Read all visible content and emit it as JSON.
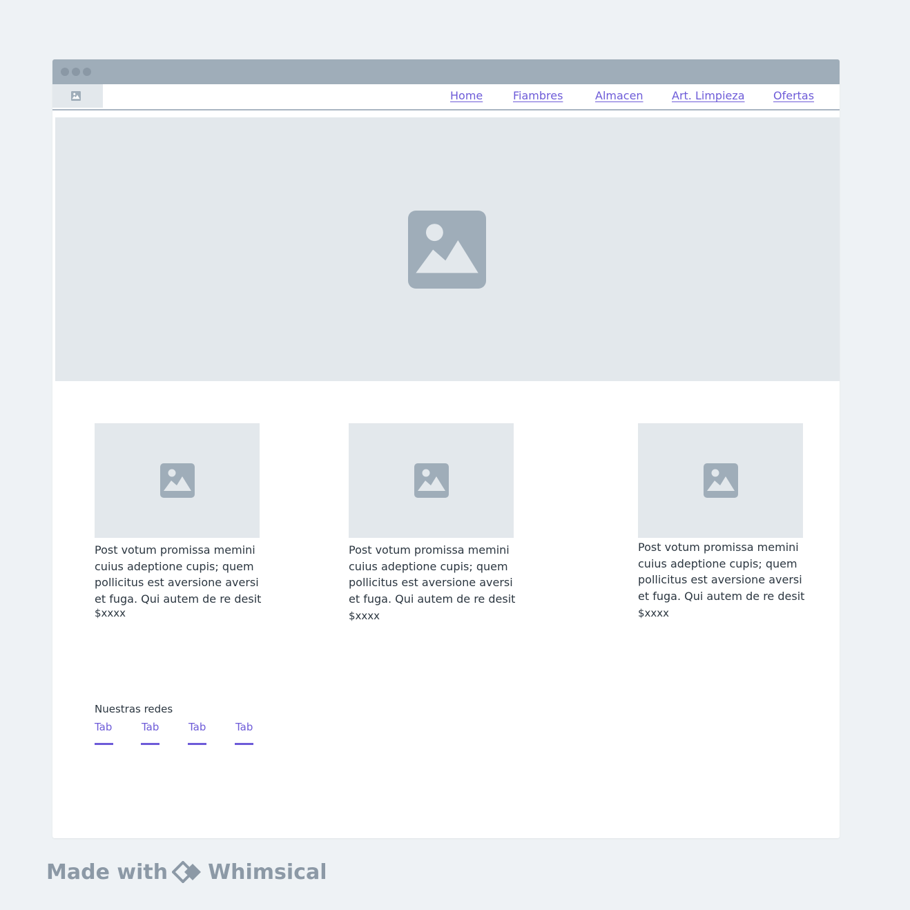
{
  "nav": {
    "links": [
      "Home",
      "Fiambres",
      "Almacen",
      "Art. Limpieza",
      "Ofertas"
    ]
  },
  "cards": [
    {
      "text": "Post votum promissa memini cuius adeptione cupis; quem pollicitus est aversione aversi et fuga. Qui autem de re desit",
      "price": "$xxxx"
    },
    {
      "text": "Post votum promissa memini cuius adeptione cupis; quem pollicitus est aversione aversi et fuga. Qui autem de re desit",
      "price": "$xxxx"
    },
    {
      "text": "Post votum promissa memini cuius adeptione cupis; quem pollicitus est aversione aversi et fuga. Qui autem de re desit",
      "price": "$xxxx"
    }
  ],
  "social": {
    "title": "Nuestras redes",
    "tabs": [
      "Tab",
      "Tab",
      "Tab",
      "Tab"
    ]
  },
  "footer": {
    "made_with": "Made with",
    "brand": "Whimsical"
  },
  "icons": {
    "logo": "image-icon",
    "hero": "image-icon",
    "card": "image-icon",
    "brand": "diamond-logo-icon"
  },
  "colors": {
    "accent": "#6d5bd8",
    "placeholder_bg": "#e3e8ec",
    "icon": "#9fadb9",
    "titlebar": "#9fadb9"
  }
}
